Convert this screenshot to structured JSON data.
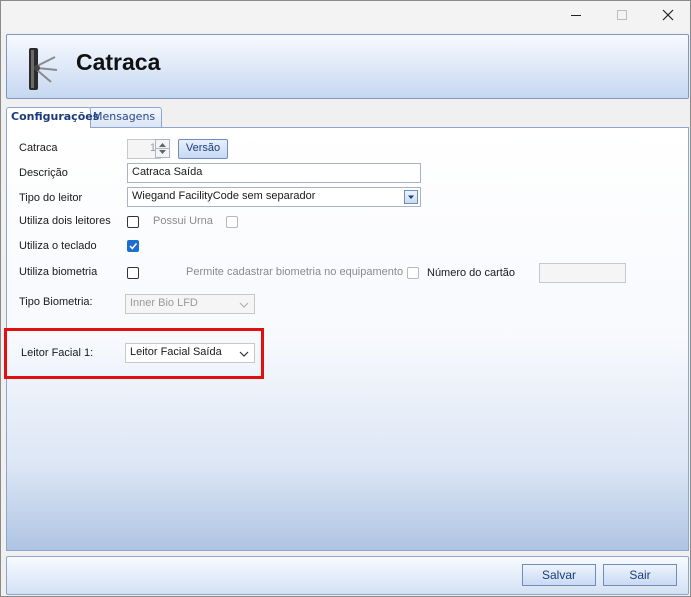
{
  "window": {
    "title_text": "Catraca"
  },
  "tabs": [
    {
      "label": "Configurações",
      "active": true
    },
    {
      "label": "Mensagens",
      "active": false
    }
  ],
  "form": {
    "catraca": {
      "label": "Catraca",
      "value": "1",
      "version_button": "Versão"
    },
    "descricao": {
      "label": "Descrição",
      "value": "Catraca Saída"
    },
    "tipo_leitor": {
      "label": "Tipo do leitor",
      "value": "Wiegand FacilityCode sem separador"
    },
    "dois_leitores": {
      "label": "Utiliza dois leitores",
      "checked": false
    },
    "possui_urna": {
      "label": "Possui Urna",
      "checked": false
    },
    "teclado": {
      "label": "Utiliza o teclado",
      "checked": true
    },
    "biometria": {
      "label": "Utiliza biometria",
      "checked": false
    },
    "cadastrar_biometria": {
      "label": "Permite cadastrar biometria no equipamento"
    },
    "numero_cartao": {
      "label": "Número do cartão",
      "checked": false,
      "value": ""
    },
    "tipo_biometria": {
      "label": "Tipo Biometria:",
      "value": "Inner Bio LFD"
    },
    "leitor_facial": {
      "label": "Leitor Facial 1:",
      "value": "Leitor Facial Saída"
    }
  },
  "footer": {
    "save_label": "Salvar",
    "exit_label": "Sair"
  },
  "colors": {
    "highlight": "#e01010",
    "checked": "#1c6ecf",
    "accent": "#1c3d7a"
  }
}
